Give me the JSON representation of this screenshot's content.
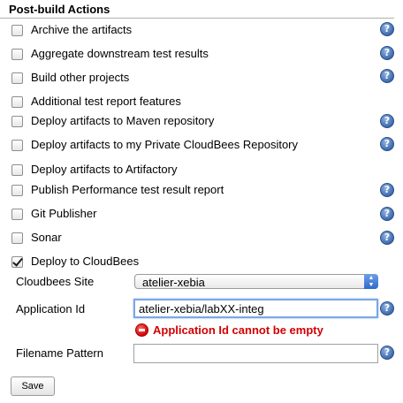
{
  "section": {
    "title": "Post-build Actions"
  },
  "actions": [
    {
      "label": "Archive the artifacts",
      "checked": false,
      "help": true
    },
    {
      "label": "Aggregate downstream test results",
      "checked": false,
      "help": true
    },
    {
      "label": "Build other projects",
      "checked": false,
      "help": true
    },
    {
      "label": "Additional test report features",
      "checked": false,
      "help": false
    },
    {
      "label": "Deploy artifacts to Maven repository",
      "checked": false,
      "help": true
    },
    {
      "label": "Deploy artifacts to my Private CloudBees Repository",
      "checked": false,
      "help": true
    },
    {
      "label": "Deploy artifacts to Artifactory",
      "checked": false,
      "help": false
    },
    {
      "label": "Publish Performance test result report",
      "checked": false,
      "help": true
    },
    {
      "label": "Git Publisher",
      "checked": false,
      "help": true
    },
    {
      "label": "Sonar",
      "checked": false,
      "help": true
    },
    {
      "label": "Deploy to CloudBees",
      "checked": true,
      "help": false
    }
  ],
  "cloudbees": {
    "site_label": "Cloudbees Site",
    "site_value": "atelier-xebia",
    "app_id_label": "Application Id",
    "app_id_value": "atelier-xebia/labXX-integ",
    "error_text": "Application Id cannot be empty",
    "filename_label": "Filename Pattern",
    "filename_value": ""
  },
  "help_glyph": "?",
  "save_label": "Save",
  "colors": {
    "error": "#d40000",
    "help": "#3d6bb0",
    "focus": "#7aa7e6"
  }
}
